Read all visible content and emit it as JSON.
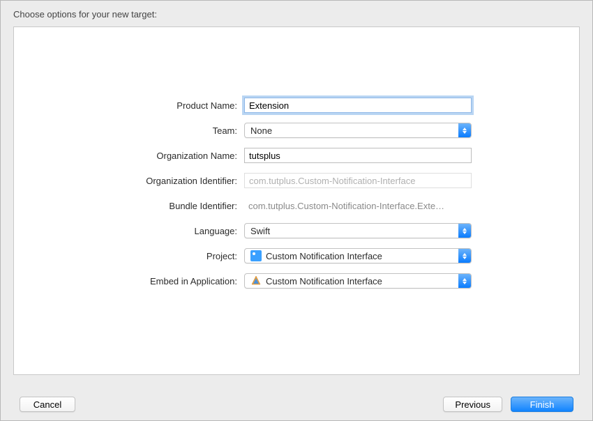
{
  "header": {
    "title": "Choose options for your new target:"
  },
  "form": {
    "productName": {
      "label": "Product Name:",
      "value": "Extension"
    },
    "team": {
      "label": "Team:",
      "value": "None"
    },
    "orgName": {
      "label": "Organization Name:",
      "value": "tutsplus"
    },
    "orgIdentifier": {
      "label": "Organization Identifier:",
      "value": "com.tutplus.Custom-Notification-Interface"
    },
    "bundleIdentifier": {
      "label": "Bundle Identifier:",
      "value": "com.tutplus.Custom-Notification-Interface.Exte…"
    },
    "language": {
      "label": "Language:",
      "value": "Swift"
    },
    "project": {
      "label": "Project:",
      "value": "Custom Notification Interface"
    },
    "embedIn": {
      "label": "Embed in Application:",
      "value": "Custom Notification Interface"
    }
  },
  "footer": {
    "cancel": "Cancel",
    "previous": "Previous",
    "finish": "Finish"
  }
}
